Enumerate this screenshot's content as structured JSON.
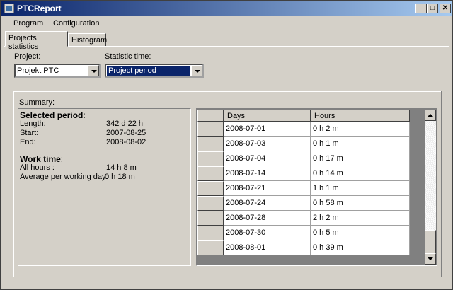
{
  "window": {
    "title": "PTCReport"
  },
  "menu": {
    "program": "Program",
    "configuration": "Configuration"
  },
  "tabs": [
    {
      "label": "Projects statistics",
      "active": true
    },
    {
      "label": "Histogram",
      "active": false
    }
  ],
  "filters": {
    "project_label": "Project:",
    "project_value": "Projekt PTC",
    "statistic_label": "Statistic time:",
    "statistic_value": "Project period"
  },
  "summary": {
    "group_label": "Summary:",
    "selected_period_heading": "Selected period",
    "selected_period_colon": ":",
    "length_label": "Length:",
    "length_value": "342 d 22 h",
    "start_label": "Start:",
    "start_value": "2007-08-25",
    "end_label": "End:",
    "end_value": "2008-08-02",
    "work_time_heading": "Work time",
    "work_time_colon": ":",
    "all_hours_label": "All hours :",
    "all_hours_value": "14 h 8 m",
    "avg_label": "Average per working day:",
    "avg_value": "0 h 18 m"
  },
  "table": {
    "headers": [
      "Days",
      "Hours"
    ],
    "rows": [
      [
        "2008-07-01",
        "0 h 2 m"
      ],
      [
        "2008-07-03",
        "0 h 1 m"
      ],
      [
        "2008-07-04",
        "0 h 17 m"
      ],
      [
        "2008-07-14",
        "0 h 14 m"
      ],
      [
        "2008-07-21",
        "1 h 1 m"
      ],
      [
        "2008-07-24",
        "0 h 58 m"
      ],
      [
        "2008-07-28",
        "2 h 2 m"
      ],
      [
        "2008-07-30",
        "0 h 5 m"
      ],
      [
        "2008-08-01",
        "0 h 39 m"
      ]
    ]
  }
}
